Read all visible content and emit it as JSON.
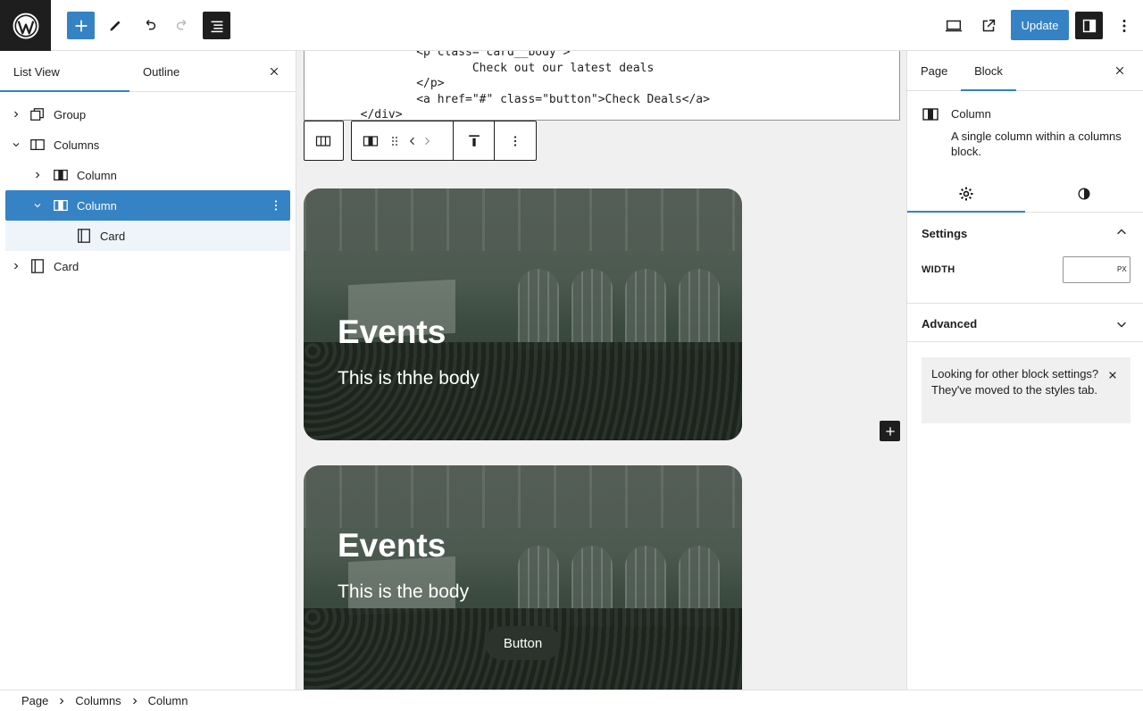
{
  "topbar": {
    "update_label": "Update"
  },
  "list_panel": {
    "tabs": [
      {
        "label": "List View",
        "active": true
      },
      {
        "label": "Outline",
        "active": false
      }
    ],
    "tree": [
      {
        "label": "Group",
        "icon": "group-icon",
        "level": 0,
        "expanded": false
      },
      {
        "label": "Columns",
        "icon": "columns-icon",
        "level": 0,
        "expanded": true
      },
      {
        "label": "Column",
        "icon": "column-icon",
        "level": 1,
        "expanded": false
      },
      {
        "label": "Column",
        "icon": "column-icon",
        "level": 1,
        "expanded": true,
        "selected": true
      },
      {
        "label": "Card",
        "icon": "card-icon",
        "level": 2
      },
      {
        "label": "Card",
        "icon": "card-icon",
        "level": 0,
        "expanded": false
      }
    ]
  },
  "editor": {
    "code_lines": [
      "                <p class=\"card__body\">",
      "                        Check out our latest deals",
      "                </p>",
      "                <a href=\"#\" class=\"button\">Check Deals</a>",
      "        </div>"
    ],
    "cards": [
      {
        "title": "Events",
        "body": "This is thhe body"
      },
      {
        "title": "Events",
        "body": "This is the body",
        "button": "Button"
      }
    ]
  },
  "settings_panel": {
    "tabs": [
      {
        "label": "Page",
        "active": false
      },
      {
        "label": "Block",
        "active": true
      }
    ],
    "block_name": "Column",
    "block_description": "A single column within a columns block.",
    "settings_title": "Settings",
    "width_label": "WIDTH",
    "width_value": "",
    "width_unit": "PX",
    "advanced_title": "Advanced",
    "notice": "Looking for other block settings? They've moved to the styles tab."
  },
  "breadcrumb": [
    "Page",
    "Columns",
    "Column"
  ],
  "colors": {
    "accent": "#3582c4",
    "dark": "#1e1e1e"
  }
}
